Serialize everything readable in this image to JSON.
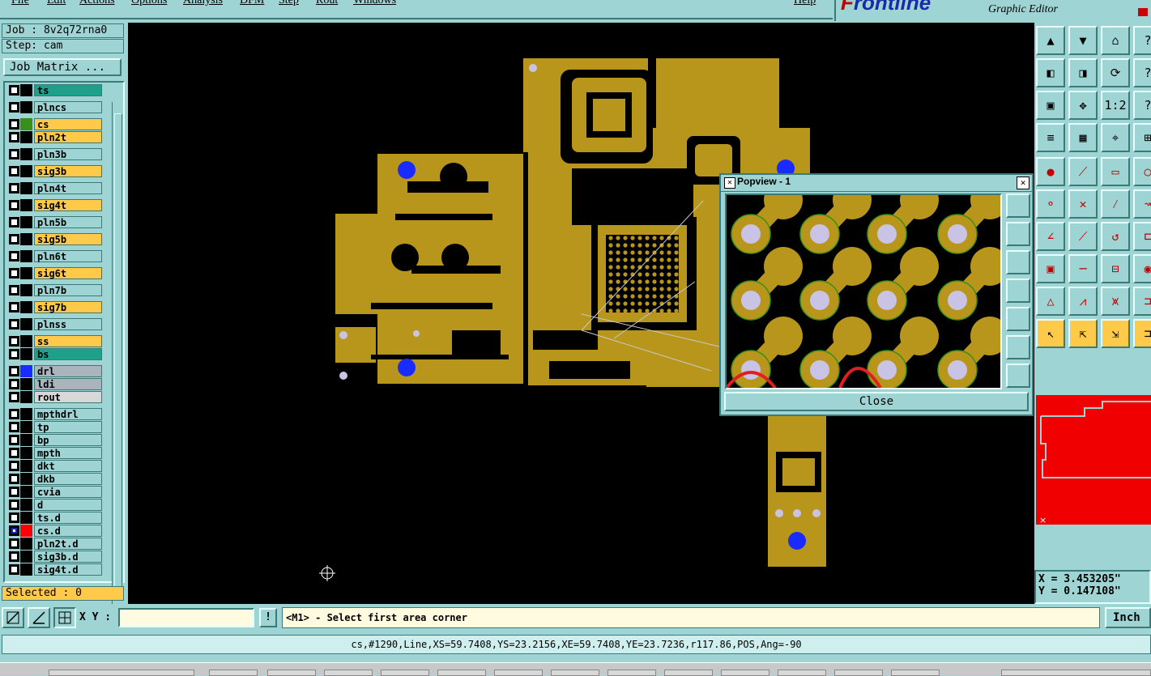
{
  "menu": {
    "items": [
      "File",
      "Edit",
      "Actions",
      "Options",
      "Analysis",
      "DFM",
      "Step",
      "Rout",
      "Windows"
    ],
    "help": "Help"
  },
  "brand": {
    "logo_f": "F",
    "logo_rest": "rontline",
    "subtitle": "Graphic Editor"
  },
  "job": {
    "job_label": "Job : 8v2q72rna0",
    "step_label": "Step: cam",
    "matrix_button": "Job Matrix ..."
  },
  "layers": [
    {
      "name": "ts",
      "bg": "#1fa08a",
      "swatch": "#000000"
    },
    {
      "name": "plncs",
      "bg": "#9fd4d4",
      "swatch": "#000000"
    },
    {
      "name": "cs",
      "bg": "#ffc94a",
      "swatch": "#3a8f1a"
    },
    {
      "name": "pln2t",
      "bg": "#ffc94a",
      "swatch": "#000000"
    },
    {
      "name": "pln3b",
      "bg": "#9fd4d4",
      "swatch": "#000000"
    },
    {
      "name": "sig3b",
      "bg": "#ffc94a",
      "swatch": "#000000"
    },
    {
      "name": "pln4t",
      "bg": "#9fd4d4",
      "swatch": "#000000"
    },
    {
      "name": "sig4t",
      "bg": "#ffc94a",
      "swatch": "#000000"
    },
    {
      "name": "pln5b",
      "bg": "#9fd4d4",
      "swatch": "#000000"
    },
    {
      "name": "sig5b",
      "bg": "#ffc94a",
      "swatch": "#000000"
    },
    {
      "name": "pln6t",
      "bg": "#9fd4d4",
      "swatch": "#000000"
    },
    {
      "name": "sig6t",
      "bg": "#ffc94a",
      "swatch": "#000000"
    },
    {
      "name": "pln7b",
      "bg": "#9fd4d4",
      "swatch": "#000000"
    },
    {
      "name": "sig7b",
      "bg": "#ffc94a",
      "swatch": "#000000"
    },
    {
      "name": "plnss",
      "bg": "#9fd4d4",
      "swatch": "#000000"
    },
    {
      "name": "ss",
      "bg": "#ffc94a",
      "swatch": "#000000"
    },
    {
      "name": "bs",
      "bg": "#1fa08a",
      "swatch": "#000000"
    },
    {
      "name": "drl",
      "bg": "#a9b4bc",
      "swatch": "#1a2bff"
    },
    {
      "name": "ldi",
      "bg": "#a9b4bc",
      "swatch": "#000000"
    },
    {
      "name": "rout",
      "bg": "#d8d8d8",
      "swatch": "#000000"
    },
    {
      "name": "mpthdrl",
      "bg": "#9fd4d4",
      "swatch": "#000000"
    },
    {
      "name": "tp",
      "bg": "#9fd4d4",
      "swatch": "#000000"
    },
    {
      "name": "bp",
      "bg": "#9fd4d4",
      "swatch": "#000000"
    },
    {
      "name": "mpth",
      "bg": "#9fd4d4",
      "swatch": "#000000"
    },
    {
      "name": "dkt",
      "bg": "#9fd4d4",
      "swatch": "#000000"
    },
    {
      "name": "dkb",
      "bg": "#9fd4d4",
      "swatch": "#000000"
    },
    {
      "name": "cvia",
      "bg": "#9fd4d4",
      "swatch": "#000000"
    },
    {
      "name": "d",
      "bg": "#9fd4d4",
      "swatch": "#000000"
    },
    {
      "name": "ts.d",
      "bg": "#9fd4d4",
      "swatch": "#000000"
    },
    {
      "name": "cs.d",
      "bg": "#9fd4d4",
      "swatch": "#ff0000"
    },
    {
      "name": "pln2t.d",
      "bg": "#9fd4d4",
      "swatch": "#000000"
    },
    {
      "name": "sig3b.d",
      "bg": "#9fd4d4",
      "swatch": "#000000"
    },
    {
      "name": "sig4t.d",
      "bg": "#9fd4d4",
      "swatch": "#000000"
    }
  ],
  "selected_label": "Selected : 0",
  "popview": {
    "title": "Popview - 1",
    "close_label": "Close"
  },
  "command": {
    "xy_label": "X Y :",
    "xy_value": "",
    "prompt": "<M1> - Select first area corner",
    "unit": "Inch"
  },
  "coords": {
    "x": "X = 3.453205\"",
    "y": "Y = 0.147108\""
  },
  "status": "cs,#1290,Line,XS=59.7408,YS=23.2156,XE=59.7408,YE=23.7236,r117.86,POS,Ang=-90",
  "colors": {
    "copper": "#b8961c",
    "drill": "#1a2bff",
    "pad": "#c9c3e6",
    "background": "#000000",
    "panel": "#9fd4d4",
    "highlight": "#ffc94a"
  }
}
